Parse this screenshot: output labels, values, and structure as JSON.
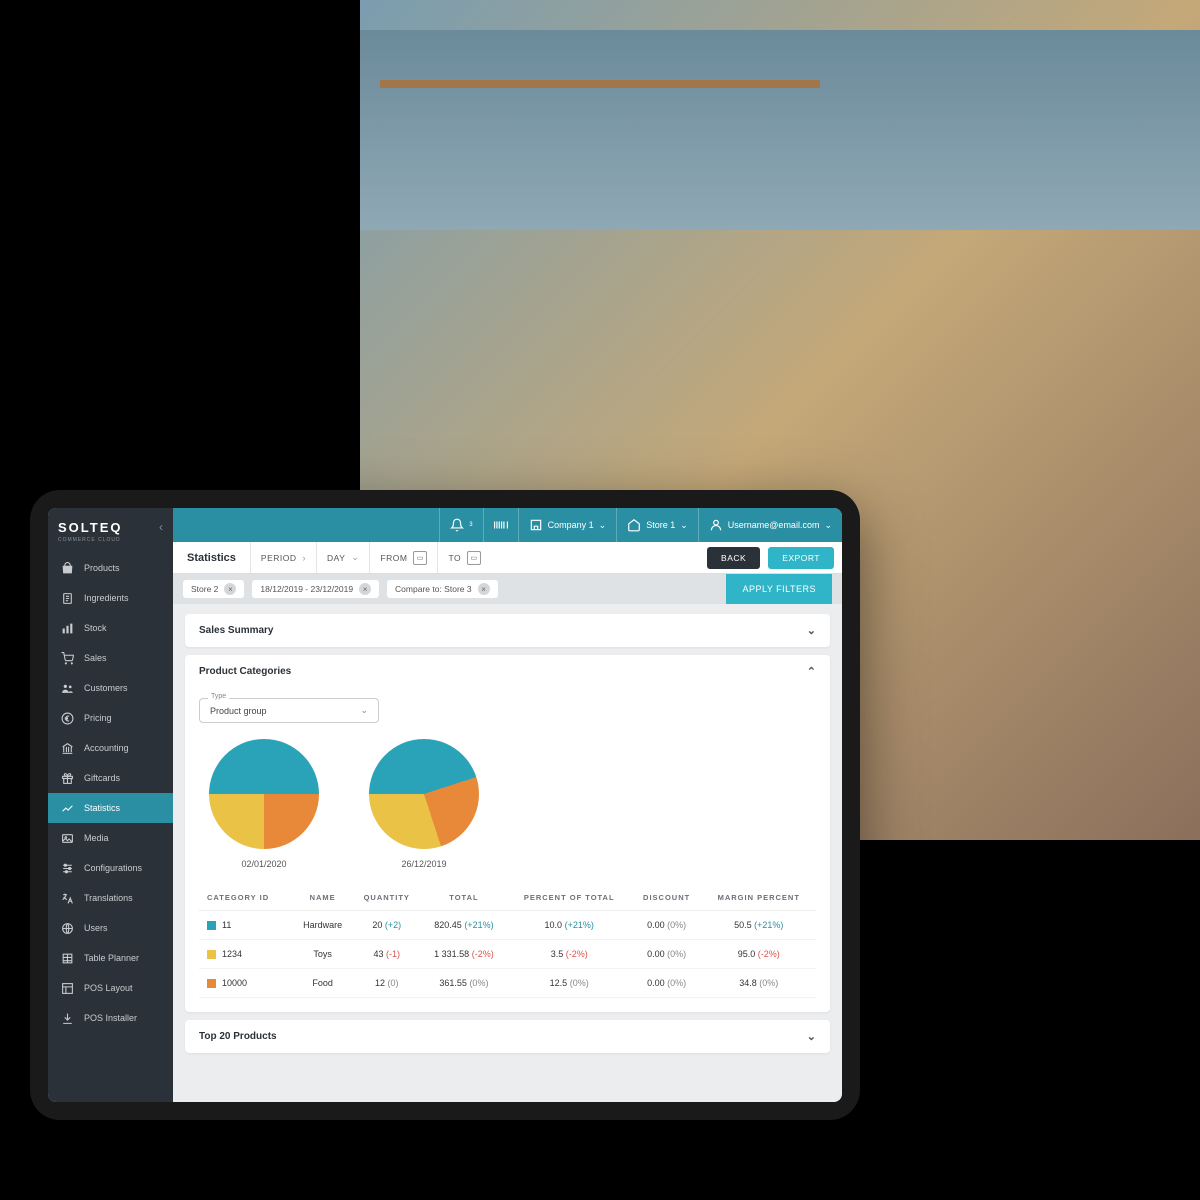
{
  "brand": {
    "name": "SOLTEQ",
    "tagline": "COMMERCE CLOUD"
  },
  "sidebar": {
    "items": [
      {
        "icon": "bag",
        "label": "Products"
      },
      {
        "icon": "doc",
        "label": "Ingredients"
      },
      {
        "icon": "bars",
        "label": "Stock"
      },
      {
        "icon": "cart",
        "label": "Sales"
      },
      {
        "icon": "people",
        "label": "Customers"
      },
      {
        "icon": "euro",
        "label": "Pricing"
      },
      {
        "icon": "bank",
        "label": "Accounting"
      },
      {
        "icon": "gift",
        "label": "Giftcards"
      },
      {
        "icon": "chart",
        "label": "Statistics"
      },
      {
        "icon": "media",
        "label": "Media"
      },
      {
        "icon": "sliders",
        "label": "Configurations"
      },
      {
        "icon": "translate",
        "label": "Translations"
      },
      {
        "icon": "globe",
        "label": "Users"
      },
      {
        "icon": "table",
        "label": "Table Planner"
      },
      {
        "icon": "layout",
        "label": "POS Layout"
      },
      {
        "icon": "install",
        "label": "POS Installer"
      }
    ],
    "active_index": 8
  },
  "topbar": {
    "notification_count": "3",
    "company": "Company 1",
    "store": "Store 1",
    "username": "Username@email.com"
  },
  "filter": {
    "title": "Statistics",
    "period_label": "PERIOD",
    "day_label": "DAY",
    "from_label": "FROM",
    "to_label": "TO",
    "back": "BACK",
    "export": "EXPORT"
  },
  "chips": {
    "c1": "Store 2",
    "c2": "18/12/2019 - 23/12/2019",
    "c3": "Compare to: Store 3",
    "apply": "APPLY FILTERS"
  },
  "sections": {
    "sales_summary": "Sales Summary",
    "product_categories": "Product Categories",
    "top20": "Top 20 Products"
  },
  "type_selector": {
    "label": "Type",
    "value": "Product group"
  },
  "chart_data": [
    {
      "type": "pie",
      "title": "02/01/2020",
      "series": [
        {
          "name": "Hardware",
          "value": 50,
          "color": "#2aa3b8"
        },
        {
          "name": "Toys",
          "value": 25,
          "color": "#e8893a"
        },
        {
          "name": "Food",
          "value": 25,
          "color": "#e9c246"
        }
      ]
    },
    {
      "type": "pie",
      "title": "26/12/2019",
      "series": [
        {
          "name": "Hardware",
          "value": 45,
          "color": "#2aa3b8"
        },
        {
          "name": "Toys",
          "value": 25,
          "color": "#e8893a"
        },
        {
          "name": "Food",
          "value": 30,
          "color": "#e9c246"
        }
      ]
    }
  ],
  "table": {
    "headers": {
      "cat": "CATEGORY ID",
      "name": "NAME",
      "qty": "QUANTITY",
      "total": "TOTAL",
      "pct": "PERCENT OF TOTAL",
      "disc": "DISCOUNT",
      "margin": "MARGIN PERCENT"
    },
    "rows": [
      {
        "color": "#2aa3b8",
        "id": "11",
        "name": "Hardware",
        "qty": "20",
        "qty_d": "(+2)",
        "qty_c": "pos",
        "total": "820.45",
        "total_d": "(+21%)",
        "total_c": "pos",
        "pct": "10.0",
        "pct_d": "(+21%)",
        "pct_c": "pos",
        "disc": "0.00",
        "disc_d": "(0%)",
        "disc_c": "z",
        "margin": "50.5",
        "margin_d": "(+21%)",
        "margin_c": "pos"
      },
      {
        "color": "#e9c246",
        "id": "1234",
        "name": "Toys",
        "qty": "43",
        "qty_d": "(-1)",
        "qty_c": "neg",
        "total": "1 331.58",
        "total_d": "(-2%)",
        "total_c": "neg",
        "pct": "3.5",
        "pct_d": "(-2%)",
        "pct_c": "neg",
        "disc": "0.00",
        "disc_d": "(0%)",
        "disc_c": "z",
        "margin": "95.0",
        "margin_d": "(-2%)",
        "margin_c": "neg"
      },
      {
        "color": "#e8893a",
        "id": "10000",
        "name": "Food",
        "qty": "12",
        "qty_d": "(0)",
        "qty_c": "z",
        "total": "361.55",
        "total_d": "(0%)",
        "total_c": "z",
        "pct": "12.5",
        "pct_d": "(0%)",
        "pct_c": "z",
        "disc": "0.00",
        "disc_d": "(0%)",
        "disc_c": "z",
        "margin": "34.8",
        "margin_d": "(0%)",
        "margin_c": "z"
      }
    ]
  }
}
